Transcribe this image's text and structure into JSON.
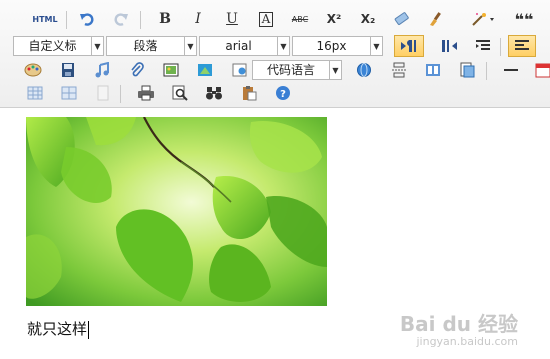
{
  "toolbar": {
    "html_label": "HTML",
    "bold": "B",
    "italic": "I",
    "underline": "U",
    "font_border": "A",
    "strike": "ABC",
    "superscript": "X²",
    "subscript": "X₂",
    "quote": "❝❝",
    "custom_title": "自定义标",
    "paragraph": "段落",
    "font_family": "arial",
    "font_size": "16px",
    "code_language": "代码语言"
  },
  "editor": {
    "body_text": "就只这样"
  },
  "watermark": {
    "brand": "Bai du 经验",
    "url": "jingyan.baidu.com"
  },
  "colors": {
    "toggle_active": "#ffcf64",
    "leaf_green": "#6cc52c"
  }
}
